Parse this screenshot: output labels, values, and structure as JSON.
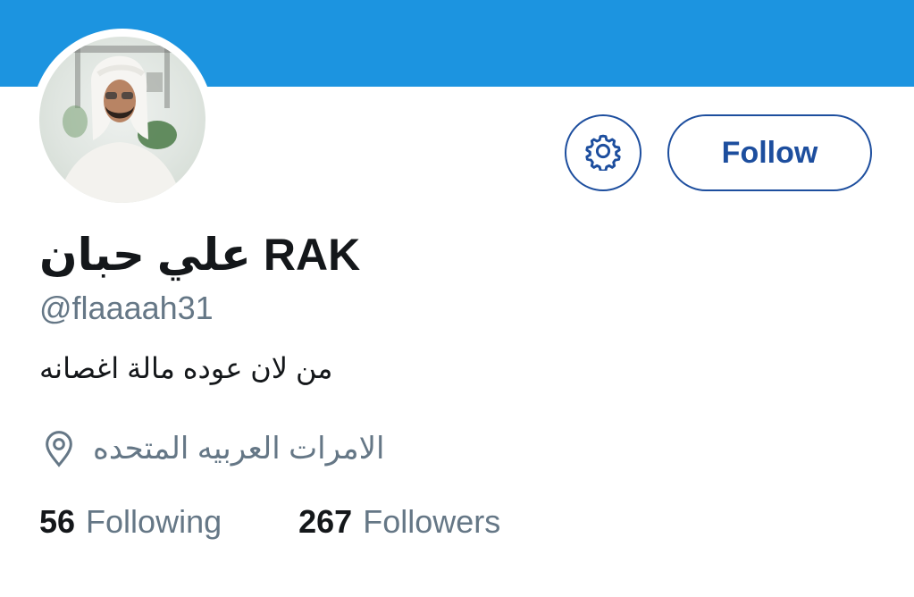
{
  "profile": {
    "display_name_arabic": "علي حبان",
    "display_name_latin": "RAK",
    "handle": "@flaaaah31",
    "bio": "من لان عوده مالة اغصانه",
    "location": "الامرات العربيه المتحده"
  },
  "actions": {
    "follow_label": "Follow",
    "settings_icon": "gear-icon"
  },
  "stats": {
    "following_count": "56",
    "following_label": "Following",
    "followers_count": "267",
    "followers_label": "Followers"
  },
  "colors": {
    "banner": "#1c94e0",
    "button_outline": "#1d4e9e",
    "text_primary": "#14171a",
    "text_secondary": "#657786"
  }
}
